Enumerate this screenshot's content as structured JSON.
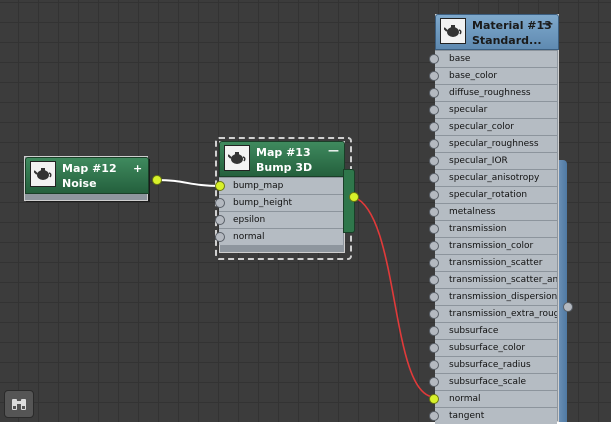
{
  "nodes": {
    "noise": {
      "title_line1": "Map #12",
      "title_line2": "Noise",
      "add_button": "+"
    },
    "bump": {
      "title_line1": "Map #13",
      "title_line2": "Bump 3D",
      "collapse_button": "—",
      "slots": [
        "bump_map",
        "bump_height",
        "epsilon",
        "normal"
      ]
    },
    "material": {
      "title_line1": "Material #13",
      "title_line2": "Standard...",
      "collapse_button": "—",
      "slots": [
        "base",
        "base_color",
        "diffuse_roughness",
        "specular",
        "specular_color",
        "specular_roughness",
        "specular_IOR",
        "specular_anisotropy",
        "specular_rotation",
        "metalness",
        "transmission",
        "transmission_color",
        "transmission_scatter",
        "transmission_scatter_ani...",
        "transmission_dispersion",
        "transmission_extra_roug...",
        "subsurface",
        "subsurface_color",
        "subsurface_radius",
        "subsurface_scale",
        "normal",
        "tangent"
      ]
    }
  },
  "colors": {
    "canvas": "#3c3c3c",
    "green_header": "#2f774b",
    "blue_header": "#6e99bf",
    "wire_white": "#ffffff",
    "wire_red": "#e03a3a",
    "active_socket": "#d8f12a"
  },
  "icons": {
    "thumbnail": "teapot-icon",
    "navigator": "binoculars-icon"
  }
}
